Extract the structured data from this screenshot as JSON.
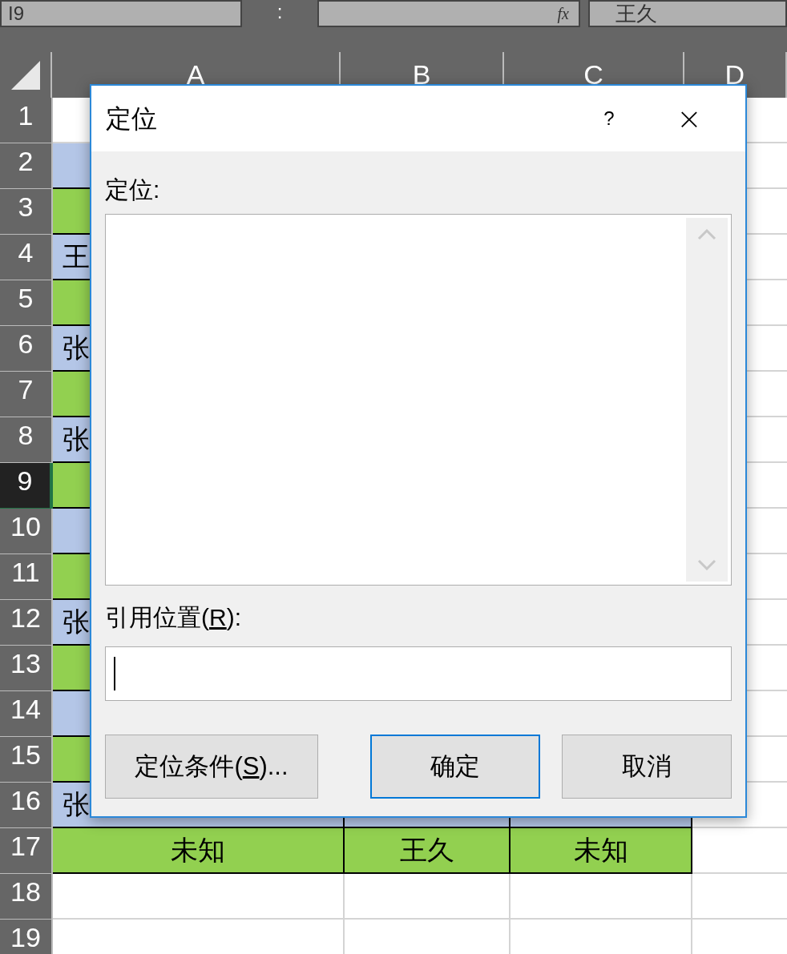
{
  "formula_bar": {
    "name_box": "I9",
    "colon": ":",
    "fx": "fx",
    "content": "王久"
  },
  "columns": [
    {
      "label": "A"
    },
    {
      "label": "B"
    },
    {
      "label": "C"
    },
    {
      "label": "D"
    }
  ],
  "rows": [
    {
      "label": "1",
      "selected": false
    },
    {
      "label": "2",
      "selected": false,
      "color": "#b4c6e7"
    },
    {
      "label": "3",
      "selected": false,
      "color": "#92d050"
    },
    {
      "label": "4",
      "selected": false,
      "color": "#b4c6e7",
      "col_a": "王"
    },
    {
      "label": "5",
      "selected": false,
      "color": "#92d050"
    },
    {
      "label": "6",
      "selected": false,
      "color": "#b4c6e7",
      "col_a": "张"
    },
    {
      "label": "7",
      "selected": false,
      "color": "#92d050"
    },
    {
      "label": "8",
      "selected": false,
      "color": "#b4c6e7",
      "col_a": "张"
    },
    {
      "label": "9",
      "selected": true,
      "color": "#92d050"
    },
    {
      "label": "10",
      "selected": false,
      "color": "#b4c6e7"
    },
    {
      "label": "11",
      "selected": false,
      "color": "#92d050"
    },
    {
      "label": "12",
      "selected": false,
      "color": "#b4c6e7",
      "col_a": "张"
    },
    {
      "label": "13",
      "selected": false,
      "color": "#92d050"
    },
    {
      "label": "14",
      "selected": false,
      "color": "#b4c6e7"
    },
    {
      "label": "15",
      "selected": false,
      "color": "#92d050"
    },
    {
      "label": "16",
      "selected": false,
      "color": "#b4c6e7",
      "col_a": "张"
    },
    {
      "label": "17",
      "selected": false,
      "color": "#92d050",
      "col_a": "未知",
      "col_b": "王久",
      "col_c": "未知"
    },
    {
      "label": "18",
      "selected": false
    },
    {
      "label": "19",
      "selected": false
    }
  ],
  "dialog": {
    "title": "定位",
    "help": "?",
    "close": "×",
    "list_label": "定位:",
    "reference_label": {
      "before": "引用位置(",
      "key": "R",
      "after": "):"
    },
    "buttons": [
      {
        "before": "定位条件(",
        "key": "S",
        "after": ")...",
        "default": false
      },
      {
        "before": "确定",
        "default": true
      },
      {
        "before": "取消",
        "default": false
      }
    ]
  }
}
